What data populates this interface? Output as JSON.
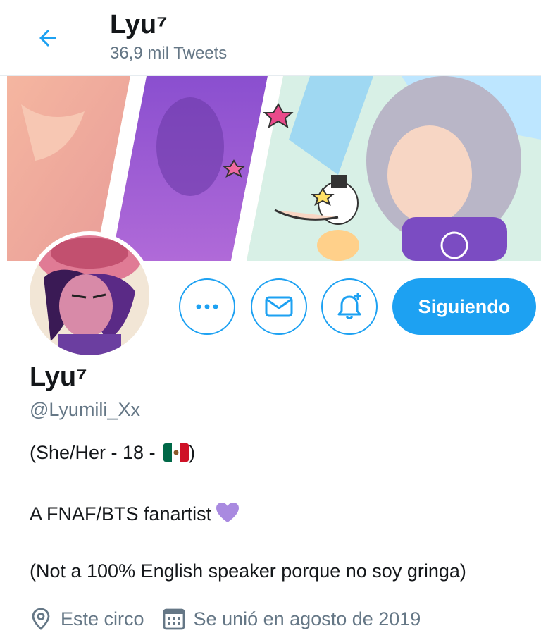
{
  "header": {
    "title": "Lyu⁷",
    "tweet_count": "36,9 mil Tweets"
  },
  "actions": {
    "follow_label": "Siguiendo"
  },
  "profile": {
    "name": "Lyu⁷",
    "handle": "@Lyumili_Xx",
    "bio_line1": "(She/Her - 18 - ",
    "bio_line1_end": ")",
    "bio_line2": "A FNAF/BTS fanartist",
    "bio_line3": "(Not a 100% English speaker porque no soy gringa)",
    "location": "Este circo",
    "joined": "Se unió en agosto de 2019"
  },
  "icons": {
    "back": "arrow-left-icon",
    "more": "more-dots-icon",
    "message": "envelope-icon",
    "notify": "bell-plus-icon",
    "location": "location-pin-icon",
    "calendar": "calendar-icon",
    "flag": "mexico-flag-icon",
    "heart": "purple-heart-icon"
  },
  "colors": {
    "accent": "#1da1f2",
    "secondary_text": "#657786",
    "primary_text": "#14171a",
    "heart": "#a98ae0"
  }
}
